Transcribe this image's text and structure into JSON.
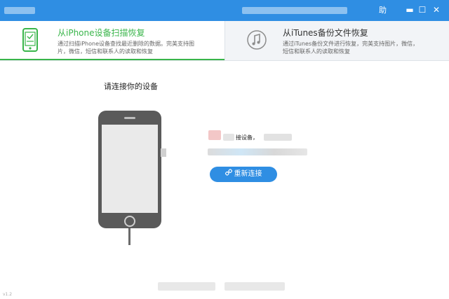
{
  "titlebar": {
    "help_label": "助",
    "minimize_glyph": "▬",
    "maximize_glyph": "☐",
    "close_glyph": "✕",
    "color": "#2f8ee3"
  },
  "modes": [
    {
      "title": "从iPhone设备扫描恢复",
      "desc": "通过扫描iPhone设备查找最近删除的数据。完美支持图片，微信，短信和联系人的读取和恢复",
      "icon": "phone-scan-icon",
      "active": true
    },
    {
      "title": "从iTunes备份文件恢复",
      "desc": "通过iTunes备份文件进行恢复，完美支持图片，微信，短信和联系人的读取和恢复",
      "icon": "itunes-music-icon",
      "active": false
    }
  ],
  "main": {
    "heading": "请连接你的设备",
    "message_fragment": "接设备，",
    "reconnect_label": "重新连接",
    "reconnect_icon": "link-icon"
  },
  "footer": {
    "version": "v1.2"
  },
  "colors": {
    "accent_green": "#39b54a",
    "accent_blue": "#2f8ee3",
    "phone_body": "#5a5a5a"
  }
}
